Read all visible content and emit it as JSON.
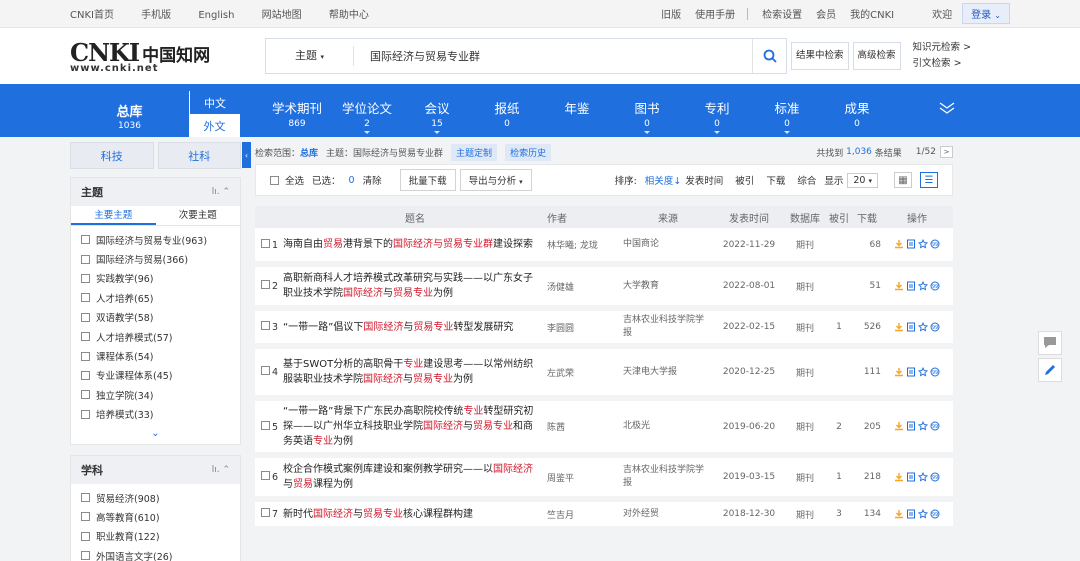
{
  "topbar": {
    "left": [
      "CNKI首页",
      "手机版",
      "English",
      "网站地图",
      "帮助中心"
    ],
    "right1": [
      "旧版",
      "使用手册"
    ],
    "right2": [
      "检索设置",
      "会员",
      "我的CNKI"
    ],
    "welcome": "欢迎",
    "login": "登录"
  },
  "logo": {
    "brand": "CNKI",
    "cn": "中国知网",
    "url": "www.cnki.net"
  },
  "search": {
    "type": "主题",
    "query": "国际经济与贸易专业群",
    "btn_in": "结果中检索",
    "btn_adv": "高级检索",
    "link1": "知识元检索",
    "link2": "引文检索"
  },
  "nav": {
    "total_label": "总库",
    "total_count": "1036",
    "lang_cn": "中文",
    "lang_en": "外文",
    "items": [
      {
        "label": "学术期刊",
        "count": "869"
      },
      {
        "label": "学位论文",
        "count": "2"
      },
      {
        "label": "会议",
        "count": "15"
      },
      {
        "label": "报纸",
        "count": "0"
      },
      {
        "label": "年鉴",
        "count": ""
      },
      {
        "label": "图书",
        "count": "0"
      },
      {
        "label": "专利",
        "count": "0"
      },
      {
        "label": "标准",
        "count": "0"
      },
      {
        "label": "成果",
        "count": "0"
      }
    ]
  },
  "sidebar": {
    "tab1": "科技",
    "tab2": "社科",
    "facet1": {
      "title": "主题",
      "sub1": "主要主题",
      "sub2": "次要主题",
      "items": [
        "国际经济与贸易专业(963)",
        "国际经济与贸易(366)",
        "实践教学(96)",
        "人才培养(65)",
        "双语教学(58)",
        "人才培养模式(57)",
        "课程体系(54)",
        "专业课程体系(45)",
        "独立学院(34)",
        "培养模式(33)"
      ]
    },
    "facet2": {
      "title": "学科",
      "items": [
        "贸易经济(908)",
        "高等教育(610)",
        "职业教育(122)",
        "外国语言文字(26)"
      ]
    }
  },
  "crumb": {
    "scope_label": "检索范围：",
    "scope": "总库",
    "topic": "主题：国际经济与贸易专业群",
    "tag1": "主题定制",
    "tag2": "检索历史",
    "found_pre": "共找到",
    "found": "1,036",
    "found_post": "条结果",
    "page": "1/52"
  },
  "toolbar": {
    "all": "全选",
    "selected_label": "已选：",
    "selected": "0",
    "clear": "清除",
    "batch": "批量下载",
    "export": "导出与分析",
    "sort_label": "排序:",
    "sort": [
      "相关度",
      "发表时间",
      "被引",
      "下载",
      "综合"
    ],
    "show_label": "显示",
    "show": "20"
  },
  "table": {
    "headers": [
      "题名",
      "作者",
      "来源",
      "发表时间",
      "数据库",
      "被引",
      "下载",
      "操作"
    ],
    "rows": [
      {
        "n": "1",
        "parts": [
          [
            "海南自由",
            0
          ],
          [
            "贸易",
            1
          ],
          [
            "港背景下的",
            0
          ],
          [
            "国际经济与贸易专业群",
            1
          ],
          [
            "建设探索",
            0
          ]
        ],
        "author": "林华曦; 龙珑",
        "source": "中国商论",
        "date": "2022-11-29",
        "db": "期刊",
        "cite": "",
        "dl": "68"
      },
      {
        "n": "2",
        "parts": [
          [
            "高职新商科人才培养模式改革研究与实践——以广东女子职业技术学院",
            0
          ],
          [
            "国际经济",
            1
          ],
          [
            "与",
            0
          ],
          [
            "贸易专业",
            1
          ],
          [
            "为例",
            0
          ]
        ],
        "author": "汤健雄",
        "source": "大学教育",
        "date": "2022-08-01",
        "db": "期刊",
        "cite": "",
        "dl": "51"
      },
      {
        "n": "3",
        "parts": [
          [
            "“一带一路”倡议下",
            0
          ],
          [
            "国际经济",
            1
          ],
          [
            "与",
            0
          ],
          [
            "贸易专业",
            1
          ],
          [
            "转型发展研究",
            0
          ]
        ],
        "author": "李圆圆",
        "source": "吉林农业科技学院学报",
        "date": "2022-02-15",
        "db": "期刊",
        "cite": "1",
        "dl": "526"
      },
      {
        "n": "4",
        "parts": [
          [
            "基于SWOT分析的高职骨干",
            0
          ],
          [
            "专业",
            1
          ],
          [
            "建设思考——以常州纺织服装职业技术学院",
            0
          ],
          [
            "国际经济",
            1
          ],
          [
            "与",
            0
          ],
          [
            "贸易专业",
            1
          ],
          [
            "为例",
            0
          ]
        ],
        "author": "左武荣",
        "source": "天津电大学报",
        "date": "2020-12-25",
        "db": "期刊",
        "cite": "",
        "dl": "111"
      },
      {
        "n": "5",
        "parts": [
          [
            "“一带一路”背景下广东民办高职院校传统",
            0
          ],
          [
            "专业",
            1
          ],
          [
            "转型研究初探——以广州华立科技职业学院",
            0
          ],
          [
            "国际经济",
            1
          ],
          [
            "与",
            0
          ],
          [
            "贸易专业",
            1
          ],
          [
            "和商务英语",
            0
          ],
          [
            "专业",
            1
          ],
          [
            "为例",
            0
          ]
        ],
        "author": "陈茜",
        "source": "北极光",
        "date": "2019-06-20",
        "db": "期刊",
        "cite": "2",
        "dl": "205"
      },
      {
        "n": "6",
        "parts": [
          [
            "校企合作模式案例库建设和案例教学研究——以",
            0
          ],
          [
            "国际经济",
            1
          ],
          [
            "与",
            0
          ],
          [
            "贸易",
            1
          ],
          [
            "课程为例",
            0
          ]
        ],
        "author": "周鉴平",
        "source": "吉林农业科技学院学报",
        "date": "2019-03-15",
        "db": "期刊",
        "cite": "1",
        "dl": "218"
      },
      {
        "n": "7",
        "parts": [
          [
            "新时代",
            0
          ],
          [
            "国际经济",
            1
          ],
          [
            "与",
            0
          ],
          [
            "贸易专业",
            1
          ],
          [
            "核心课程群构建",
            0
          ]
        ],
        "author": "竺吉月",
        "source": "对外经贸",
        "date": "2018-12-30",
        "db": "期刊",
        "cite": "3",
        "dl": "134"
      }
    ]
  },
  "colors": {
    "accent": "#1f6fde",
    "highlight": "#d0182d",
    "download": "#f5a623",
    "read": "#1f6fde",
    "fav": "#1f6fde"
  }
}
